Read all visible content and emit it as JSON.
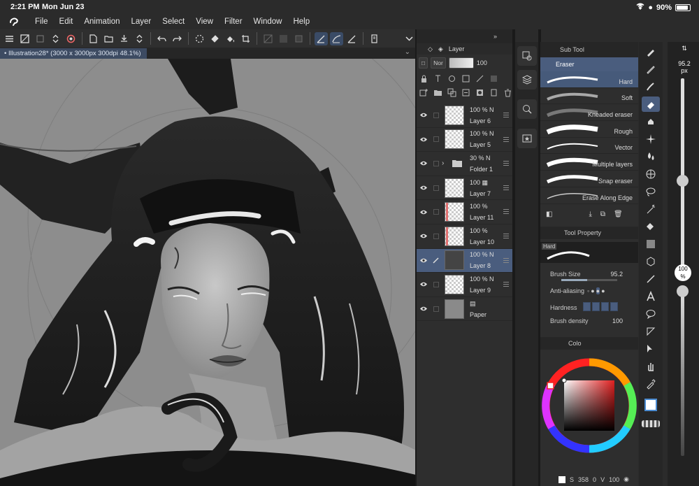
{
  "status": {
    "time": "2:21 PM",
    "date": "Mon Jun 23",
    "battery": "90%"
  },
  "menu": [
    "File",
    "Edit",
    "Animation",
    "Layer",
    "Select",
    "View",
    "Filter",
    "Window",
    "Help"
  ],
  "canvas_tab": {
    "label": "Illustration28* (3000 x 3000px 300dpi 48.1%)"
  },
  "layer_panel": {
    "title": "Layer",
    "blend_mode": "Nor",
    "opacity": "100",
    "layers": [
      {
        "opacity": "100 %",
        "blend": "N",
        "name": "Layer 6"
      },
      {
        "opacity": "100 %",
        "blend": "N",
        "name": "Layer 5"
      },
      {
        "opacity": "30 %",
        "blend": "N",
        "name": "Folder 1"
      },
      {
        "opacity": "100",
        "blend": "",
        "name": "Layer 7"
      },
      {
        "opacity": "100 %",
        "blend": "",
        "name": "Layer 11"
      },
      {
        "opacity": "100 %",
        "blend": "",
        "name": "Layer 10"
      },
      {
        "opacity": "100 %",
        "blend": "N",
        "name": "Layer 8"
      },
      {
        "opacity": "100 %",
        "blend": "N",
        "name": "Layer 9"
      },
      {
        "opacity": "",
        "blend": "",
        "name": "Paper"
      }
    ]
  },
  "subtool_panel": {
    "title": "Sub Tool",
    "group": "Eraser",
    "brushes": [
      "Hard",
      "Soft",
      "Kneaded eraser",
      "Rough",
      "Vector",
      "Multiple layers",
      "Snap eraser",
      "Erase Along Edge"
    ]
  },
  "tool_property": {
    "title": "Tool Property",
    "preview_label": "Hard",
    "brush_size_label": "Brush Size",
    "brush_size_value": "95.2",
    "antialiasing_label": "Anti-aliasing",
    "hardness_label": "Hardness",
    "brush_density_label": "Brush density",
    "brush_density_value": "100"
  },
  "color_panel": {
    "title": "Colo"
  },
  "bottom_info": {
    "s": "358",
    "v": "0",
    "v2": "100"
  },
  "right_slider": {
    "size_value": "95.2",
    "size_unit": "px",
    "opacity_value": "100",
    "opacity_unit": "%",
    "size_level": 0.46,
    "opacity_level": 0.0
  },
  "colors": {
    "accent": "#4a5d7e",
    "panel": "#2e2e2e",
    "dark": "#262626",
    "main_color": "#ffffff"
  }
}
